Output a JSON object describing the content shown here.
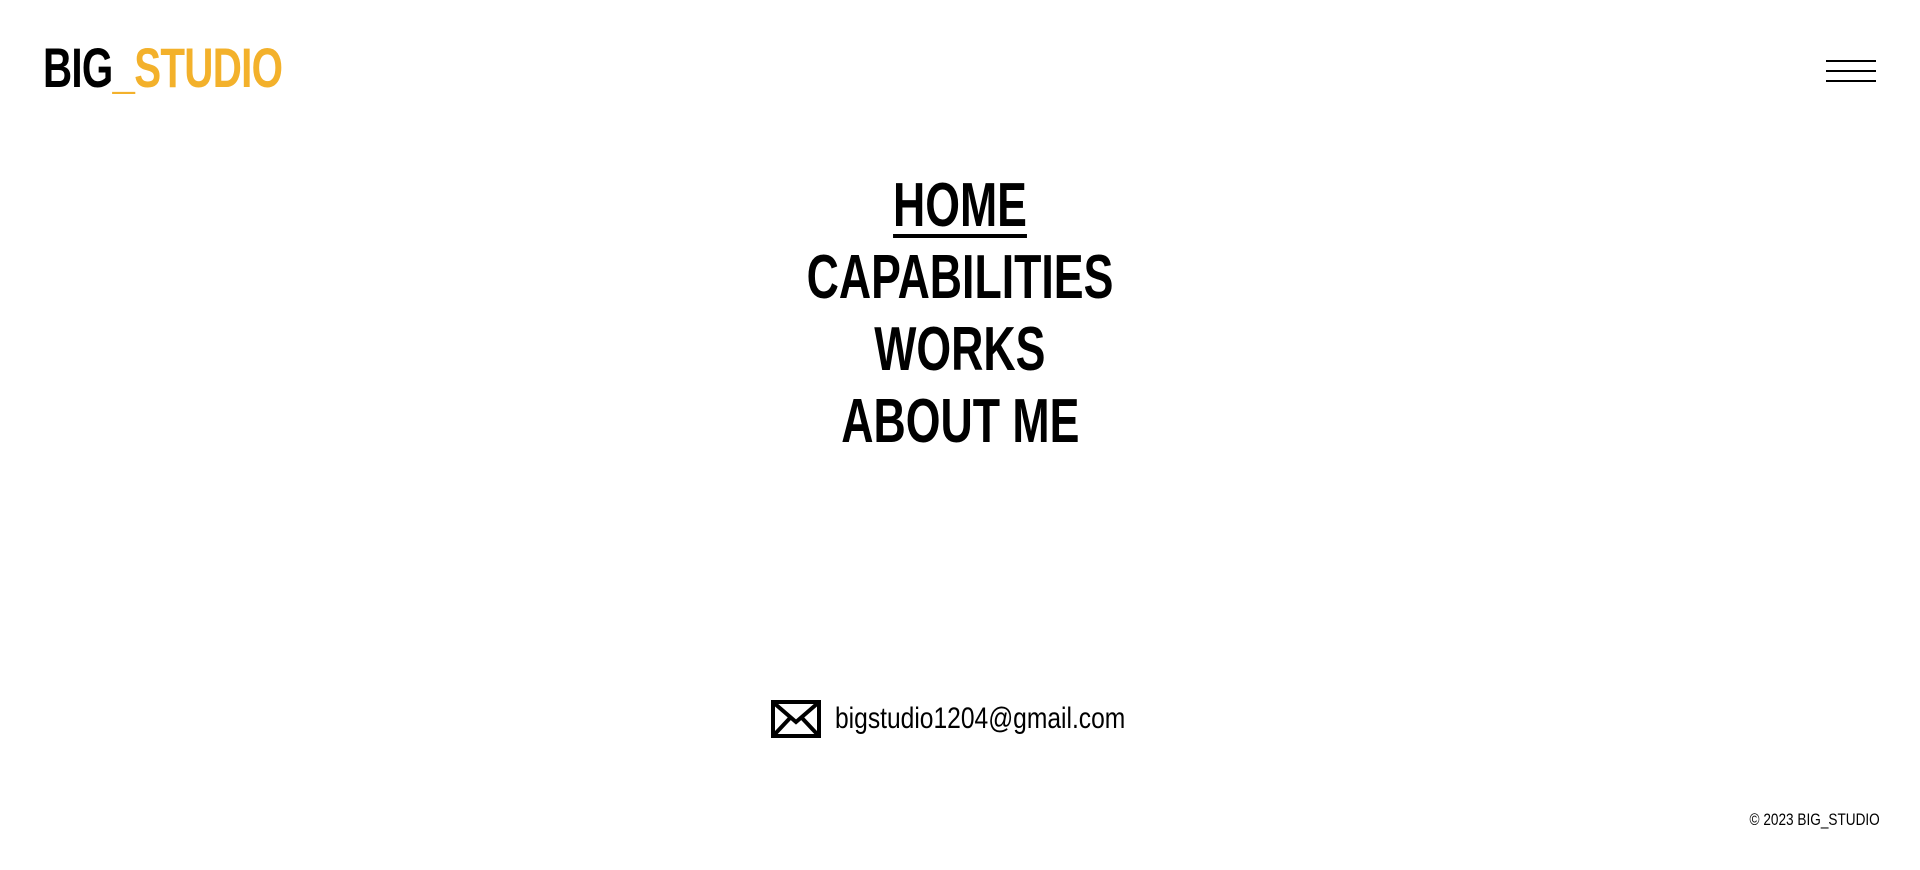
{
  "header": {
    "logo_dark": "BIG",
    "logo_accent": "_STUDIO",
    "menu_icon": "hamburger-menu-icon"
  },
  "nav": {
    "items": [
      {
        "label": "HOME",
        "active": true
      },
      {
        "label": "CAPABILITIES",
        "active": false
      },
      {
        "label": "WORKS",
        "active": false
      },
      {
        "label": "ABOUT ME",
        "active": false
      }
    ]
  },
  "contact": {
    "icon": "envelope-icon",
    "email": "bigstudio1204@gmail.com"
  },
  "footer": {
    "copyright": "© 2023 BIG_STUDIO"
  },
  "colors": {
    "accent": "#F3B12B",
    "text": "#000000",
    "background": "#FFFFFF"
  }
}
